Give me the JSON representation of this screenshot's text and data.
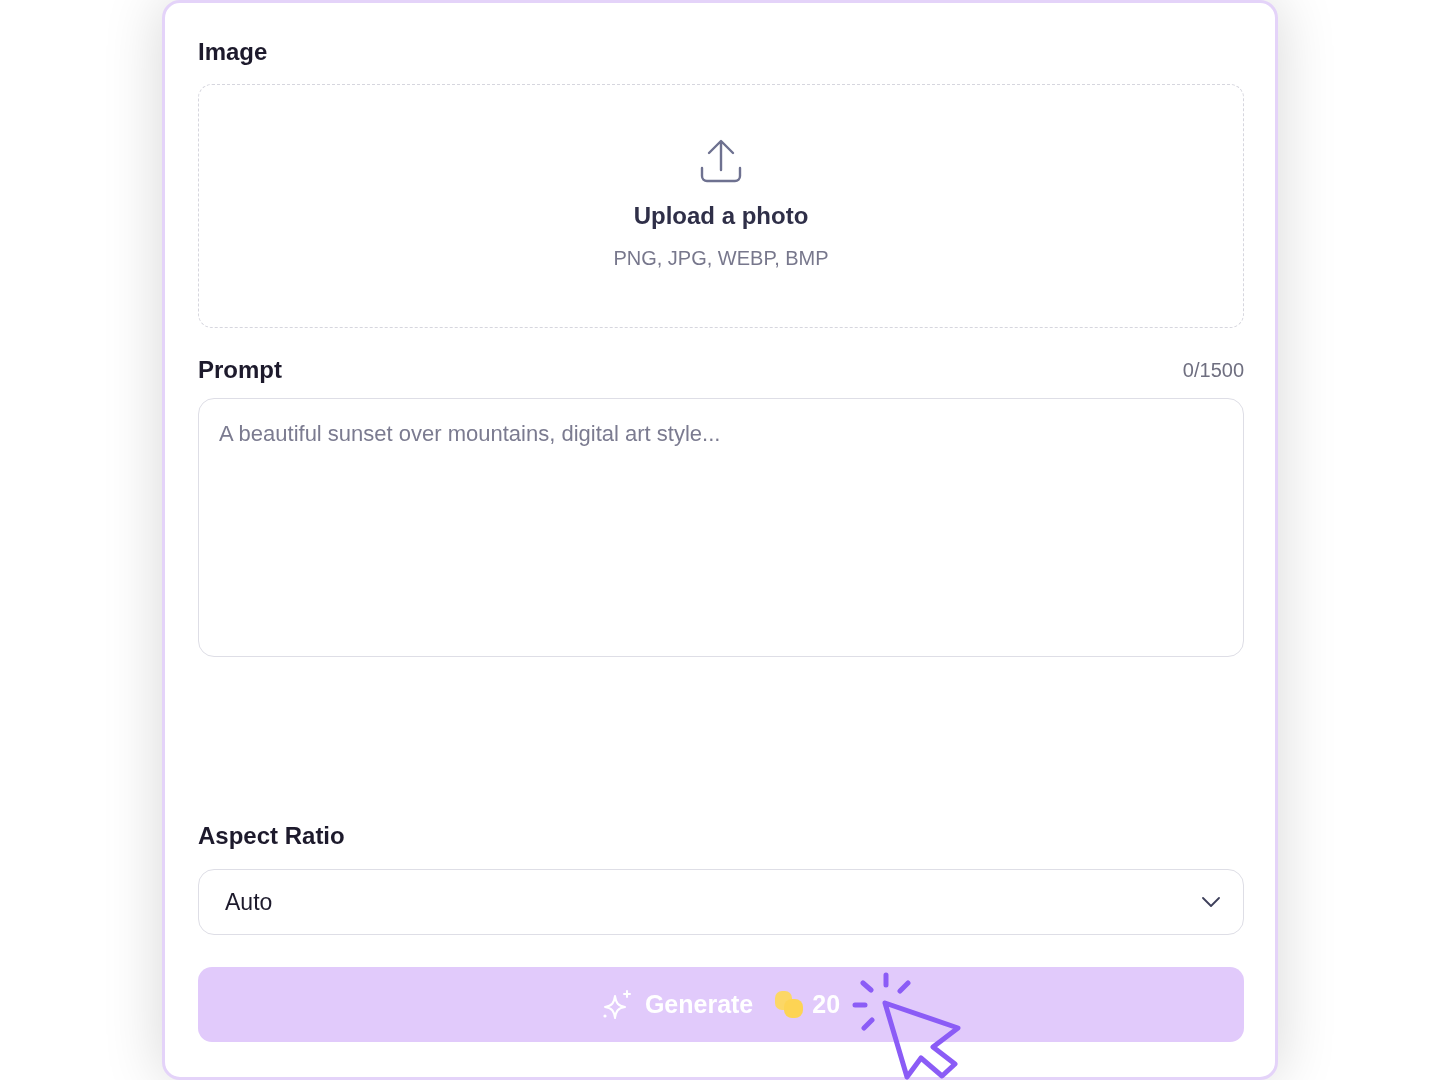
{
  "form": {
    "image": {
      "label": "Image",
      "upload": {
        "title": "Upload a photo",
        "formats": "PNG, JPG, WEBP, BMP"
      }
    },
    "prompt": {
      "label": "Prompt",
      "counter": "0/1500",
      "placeholder": "A beautiful sunset over mountains, digital art style..."
    },
    "aspect_ratio": {
      "label": "Aspect Ratio",
      "value": "Auto"
    },
    "generate_button": {
      "label": "Generate",
      "credits": "20",
      "disabled": true
    }
  }
}
